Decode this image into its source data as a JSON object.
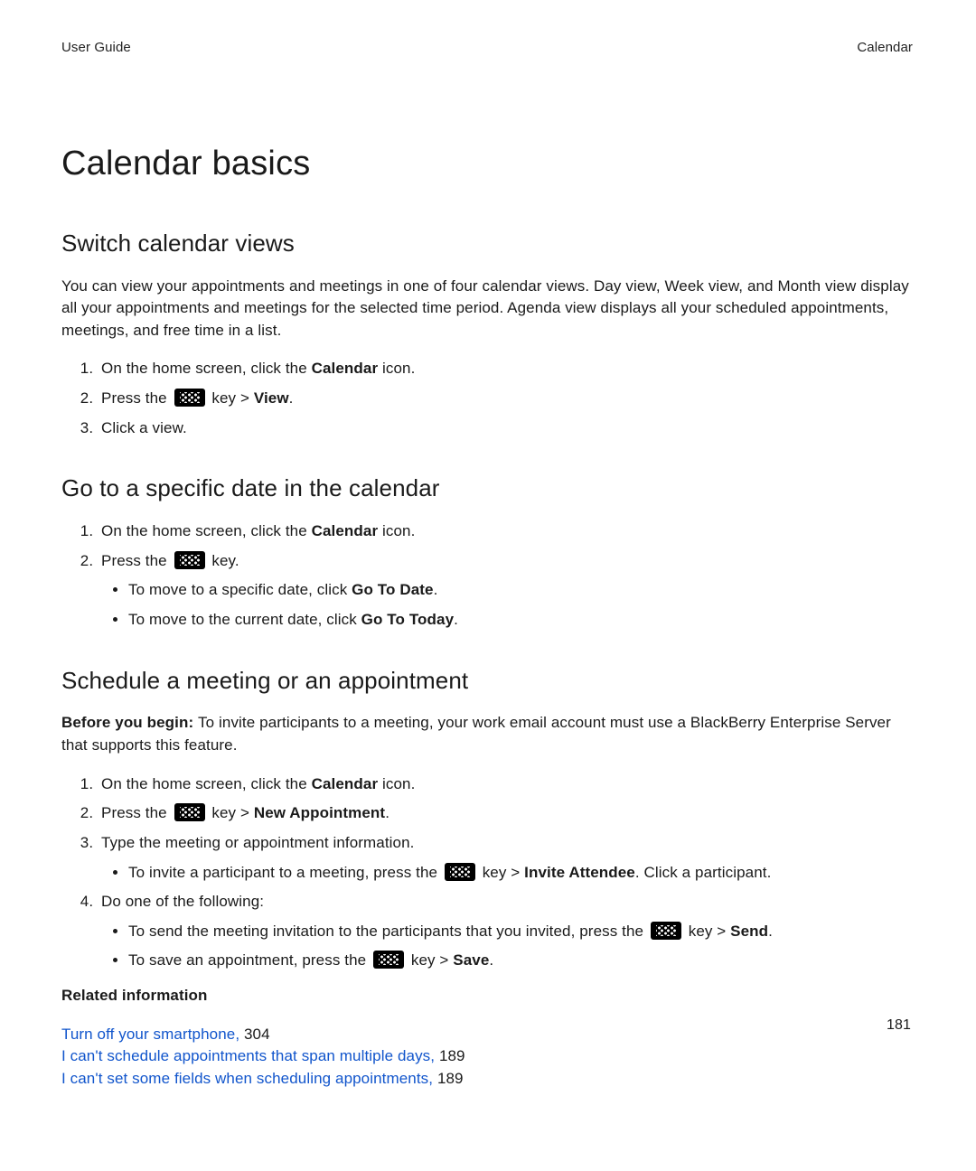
{
  "header": {
    "left": "User Guide",
    "right": "Calendar"
  },
  "title": "Calendar basics",
  "section1": {
    "heading": "Switch calendar views",
    "intro": "You can view your appointments and meetings in one of four calendar views. Day view, Week view, and Month view display all your appointments and meetings for the selected time period. Agenda view displays all your scheduled appointments, meetings, and free time in a list.",
    "step1_pre": "On the home screen, click the ",
    "step1_bold": "Calendar",
    "step1_post": " icon.",
    "step2_pre": "Press the ",
    "step2_mid": " key > ",
    "step2_bold": "View",
    "step2_post": ".",
    "step3": "Click a view."
  },
  "section2": {
    "heading": "Go to a specific date in the calendar",
    "step1_pre": "On the home screen, click the ",
    "step1_bold": "Calendar",
    "step1_post": " icon.",
    "step2_pre": "Press the ",
    "step2_post": " key.",
    "bullet1_pre": "To move to a specific date, click ",
    "bullet1_bold": "Go To Date",
    "bullet1_post": ".",
    "bullet2_pre": "To move to the current date, click ",
    "bullet2_bold": "Go To Today",
    "bullet2_post": "."
  },
  "section3": {
    "heading": "Schedule a meeting or an appointment",
    "before_label": "Before you begin: ",
    "before_text": "To invite participants to a meeting, your work email account must use a BlackBerry Enterprise Server that supports this feature.",
    "step1_pre": "On the home screen, click the ",
    "step1_bold": "Calendar",
    "step1_post": " icon.",
    "step2_pre": "Press the ",
    "step2_mid": " key > ",
    "step2_bold": "New Appointment",
    "step2_post": ".",
    "step3": "Type the meeting or appointment information.",
    "step3_b1_pre": "To invite a participant to a meeting, press the ",
    "step3_b1_mid": " key > ",
    "step3_b1_bold": "Invite Attendee",
    "step3_b1_post": ". Click a participant.",
    "step4": "Do one of the following:",
    "step4_b1_pre": "To send the meeting invitation to the participants that you invited, press the ",
    "step4_b1_mid": " key > ",
    "step4_b1_bold": "Send",
    "step4_b1_post": ".",
    "step4_b2_pre": "To save an appointment, press the ",
    "step4_b2_mid": " key > ",
    "step4_b2_bold": "Save",
    "step4_b2_post": "."
  },
  "related": {
    "title": "Related information",
    "link1": "Turn off your smartphone, ",
    "page1": "304",
    "link2": "I can't schedule appointments that span multiple days, ",
    "page2": "189",
    "link3": "I can't set some fields when scheduling appointments, ",
    "page3": "189"
  },
  "page_number": "181"
}
